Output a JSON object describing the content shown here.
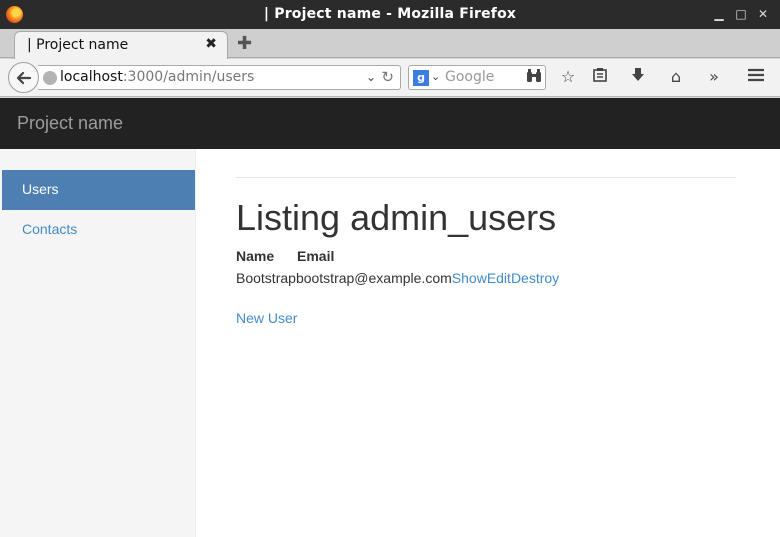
{
  "window": {
    "title": "| Project name - Mozilla Firefox"
  },
  "tab": {
    "title": "| Project name",
    "close_glyph": "✖"
  },
  "nav": {
    "url_host": "localhost",
    "url_path": ":3000/admin/users",
    "search_placeholder": "Google",
    "search_engine_letter": "g"
  },
  "app": {
    "brand": "Project name"
  },
  "sidebar": {
    "items": [
      {
        "label": "Users",
        "active": true
      },
      {
        "label": "Contacts",
        "active": false
      }
    ]
  },
  "main": {
    "heading": "Listing admin_users",
    "columns": [
      "Name",
      "Email"
    ],
    "rows": [
      {
        "name": "Bootstrap",
        "email": "bootstrap@example.com",
        "actions": [
          "Show",
          "Edit",
          "Destroy"
        ]
      }
    ],
    "new_link": "New User"
  },
  "colors": {
    "accent": "#428bca",
    "sidebar_active": "#4e7fb3",
    "app_navbar": "#222222"
  }
}
